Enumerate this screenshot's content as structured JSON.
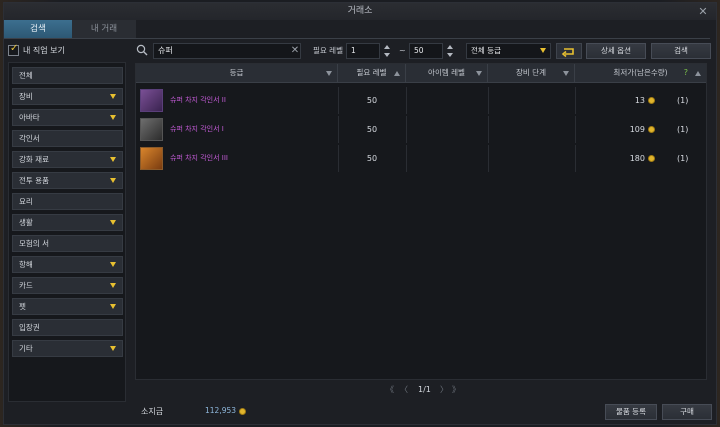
{
  "window": {
    "title": "거래소"
  },
  "tabs": {
    "search": "검색",
    "my_trades": "내 거래"
  },
  "filter": {
    "my_class_only": "내 직업 보기"
  },
  "sidebar": {
    "items": [
      {
        "label": "전체",
        "has_chevron": false
      },
      {
        "label": "장비",
        "has_chevron": true
      },
      {
        "label": "아바타",
        "has_chevron": true
      },
      {
        "label": "각인서",
        "has_chevron": false
      },
      {
        "label": "강화 재료",
        "has_chevron": true
      },
      {
        "label": "전투 용품",
        "has_chevron": true
      },
      {
        "label": "요리",
        "has_chevron": false
      },
      {
        "label": "생활",
        "has_chevron": true
      },
      {
        "label": "모험의 서",
        "has_chevron": false
      },
      {
        "label": "항해",
        "has_chevron": true
      },
      {
        "label": "카드",
        "has_chevron": true
      },
      {
        "label": "펫",
        "has_chevron": true
      },
      {
        "label": "입장권",
        "has_chevron": false
      },
      {
        "label": "기타",
        "has_chevron": true
      }
    ]
  },
  "search": {
    "value": "슈퍼",
    "level_label": "필요 레벨",
    "level_min": "1",
    "level_max": "50",
    "tilde": "~",
    "grade_select": "전체 등급",
    "detail_options": "상세 옵션",
    "search_button": "검색"
  },
  "table": {
    "headers": {
      "grade": "등급",
      "req_level": "필요 레벨",
      "item_level": "아이템 레벨",
      "equip_stage": "장비 단계",
      "lowest_price": "최저가(남은수량)",
      "help": "?"
    },
    "rows": [
      {
        "name": "슈퍼 차지 각인서 II",
        "level": "50",
        "price": "13",
        "qty": "(1)",
        "icon_color": "#5a3a6e"
      },
      {
        "name": "슈퍼 차지 각인서 I",
        "level": "50",
        "price": "109",
        "qty": "(1)",
        "icon_color": "#4a4a4a"
      },
      {
        "name": "슈퍼 차지 각인서 III",
        "level": "50",
        "price": "180",
        "qty": "(1)",
        "icon_color": "#b86a1e"
      }
    ]
  },
  "pagination": {
    "first": "《",
    "prev": "〈",
    "page": "1/1",
    "next": "〉",
    "last": "》"
  },
  "footer": {
    "gold_label": "소지금",
    "gold_value": "112,953",
    "register_button": "물품 등록",
    "buy_button": "구매"
  },
  "colors": {
    "accent_tab": "#3c6f8f",
    "chevron": "#e8c030",
    "item_name": "#c35bd6",
    "gold": "#e1b52d"
  }
}
